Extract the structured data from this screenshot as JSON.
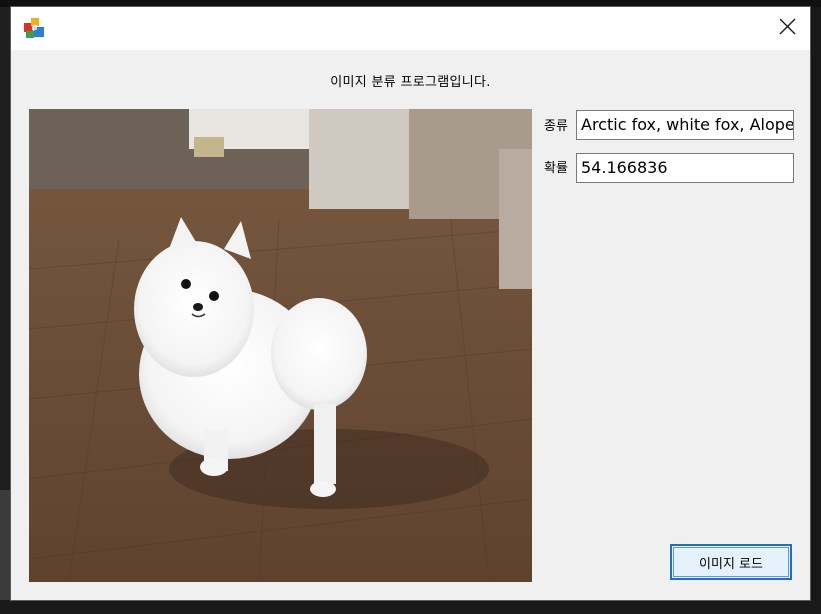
{
  "window": {
    "heading": "이미지 분류 프로그램입니다.",
    "close_icon": "close-icon",
    "app_icon": "colored-cubes-icon"
  },
  "form": {
    "species_label": "종류",
    "species_value": "Arctic fox, white fox, Alopex lagopus",
    "probability_label": "확률",
    "probability_value": "54.166836"
  },
  "actions": {
    "load_image_label": "이미지 로드"
  },
  "image": {
    "subject": "white-pomeranian-dog"
  }
}
